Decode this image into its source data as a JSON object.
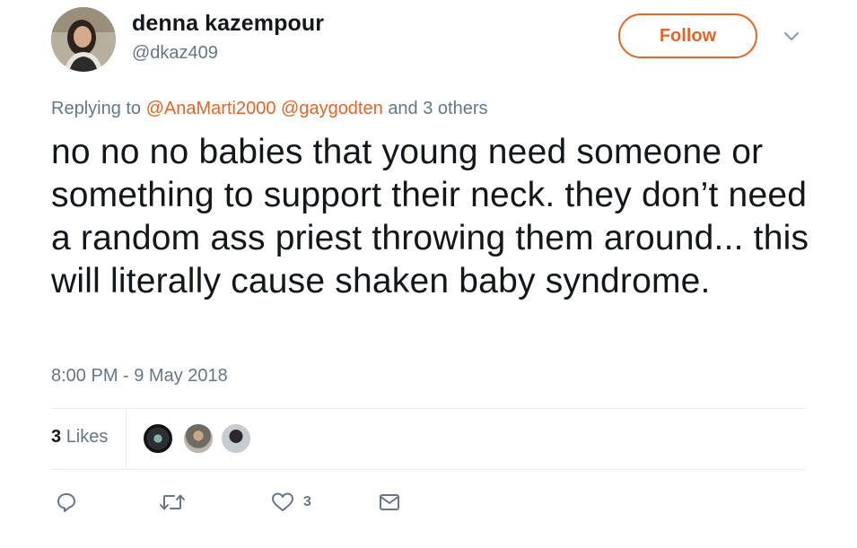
{
  "user": {
    "display_name": "denna kazempour",
    "handle": "@dkaz409"
  },
  "header": {
    "follow_label": "Follow",
    "more_icon": "chevron-down-icon"
  },
  "reply_context": {
    "prefix": "Replying to",
    "mentions": [
      "@AnaMarti2000",
      "@gaygodten"
    ],
    "suffix": "and 3 others"
  },
  "tweet": {
    "text": "no no no babies that young need someone or something to support their neck. they don’t need a random ass priest throwing them around... this will literally cause shaken baby syndrome.",
    "timestamp": "8:00 PM - 9 May 2018"
  },
  "stats": {
    "likes_count": "3",
    "likes_label": "Likes"
  },
  "actions": {
    "reply_icon": "reply-icon",
    "retweet_icon": "retweet-icon",
    "like_icon": "heart-icon",
    "like_count": "3",
    "dm_icon": "envelope-icon"
  },
  "colors": {
    "accent": "#e0662a",
    "secondary_text": "#657786",
    "primary_text": "#14171a",
    "divider": "#e6ecf0"
  }
}
